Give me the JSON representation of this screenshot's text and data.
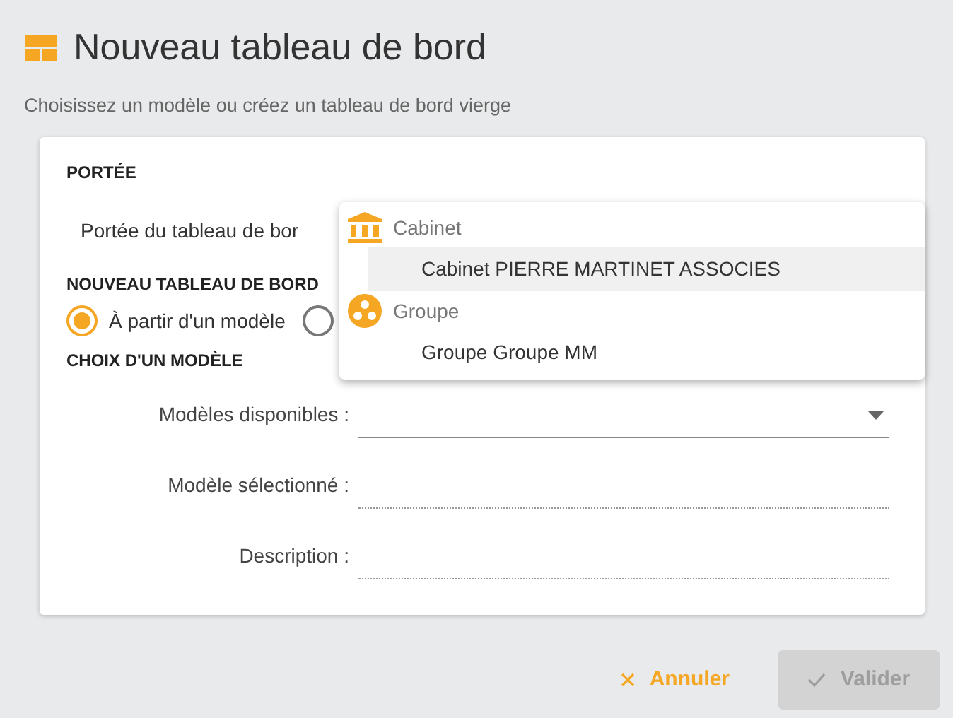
{
  "header": {
    "title": "Nouveau tableau de bord",
    "subtitle": "Choisissez un modèle ou créez un tableau de bord vierge"
  },
  "sections": [
    {
      "kind": "scope",
      "heading": "PORTÉE",
      "label": "Portée du tableau de bor"
    },
    {
      "kind": "radios",
      "heading": "NOUVEAU TABLEAU DE BORD",
      "options": [
        {
          "label": "À partir d'un modèle",
          "selected": true
        },
        {
          "selected": false
        }
      ]
    },
    {
      "kind": "form",
      "heading": "CHOIX D'UN MODÈLE",
      "fields": [
        {
          "kind": "select",
          "label": "Modèles disponibles :"
        },
        {
          "kind": "readonly",
          "label": "Modèle sélectionné :"
        },
        {
          "kind": "readonly",
          "label": "Description :"
        }
      ]
    }
  ],
  "dropdown": {
    "groups": [
      {
        "kind": "building",
        "label": "Cabinet",
        "items": [
          {
            "label": "Cabinet PIERRE MARTINET ASSOCIES",
            "highlighted": true
          }
        ]
      },
      {
        "kind": "group",
        "label": "Groupe",
        "items": [
          {
            "label": "Groupe Groupe MM",
            "highlighted": false
          }
        ]
      }
    ]
  },
  "buttons": [
    {
      "kind": "cancel",
      "label": "Annuler"
    },
    {
      "kind": "ok",
      "label": "Valider",
      "disabled": true
    }
  ]
}
